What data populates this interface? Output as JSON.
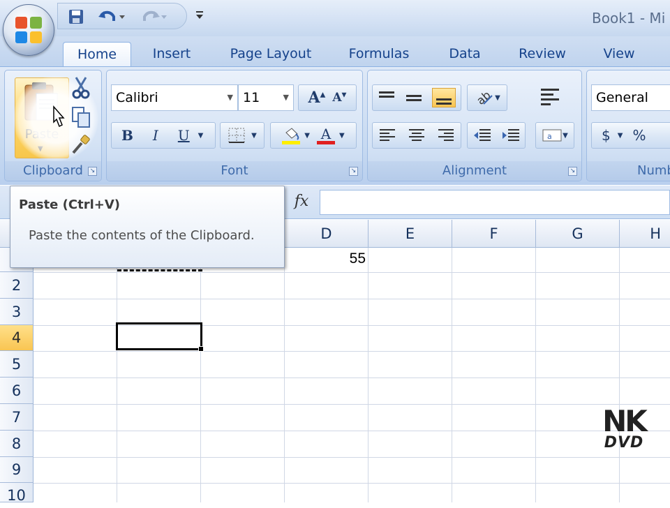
{
  "window": {
    "title": "Book1 - Mi"
  },
  "tabs": [
    "Home",
    "Insert",
    "Page Layout",
    "Formulas",
    "Data",
    "Review",
    "View"
  ],
  "active_tab": "Home",
  "ribbon": {
    "clipboard": {
      "label": "Clipboard",
      "paste_label": "Paste"
    },
    "font": {
      "label": "Font",
      "font_name": "Calibri",
      "font_size": "11"
    },
    "alignment": {
      "label": "Alignment"
    },
    "number": {
      "label": "Numb",
      "format": "General",
      "currency": "$",
      "percent": "%"
    }
  },
  "formula_bar": {
    "fx": "fx"
  },
  "tooltip": {
    "title": "Paste (Ctrl+V)",
    "body": "Paste the contents of the Clipboard."
  },
  "grid": {
    "columns": [
      "D",
      "E",
      "F",
      "G",
      "H"
    ],
    "rows": [
      "2",
      "3",
      "4",
      "5",
      "6",
      "7",
      "8",
      "9",
      "10"
    ],
    "selected_row": "4",
    "cells": {
      "D1": "55"
    }
  },
  "watermark": {
    "line1": "NK",
    "line2": "DVD"
  },
  "colors": {
    "accent": "#15428b",
    "highlight": "#f9c552",
    "font_color_bar": "#e02020",
    "fill_color_bar": "#ffee00"
  }
}
